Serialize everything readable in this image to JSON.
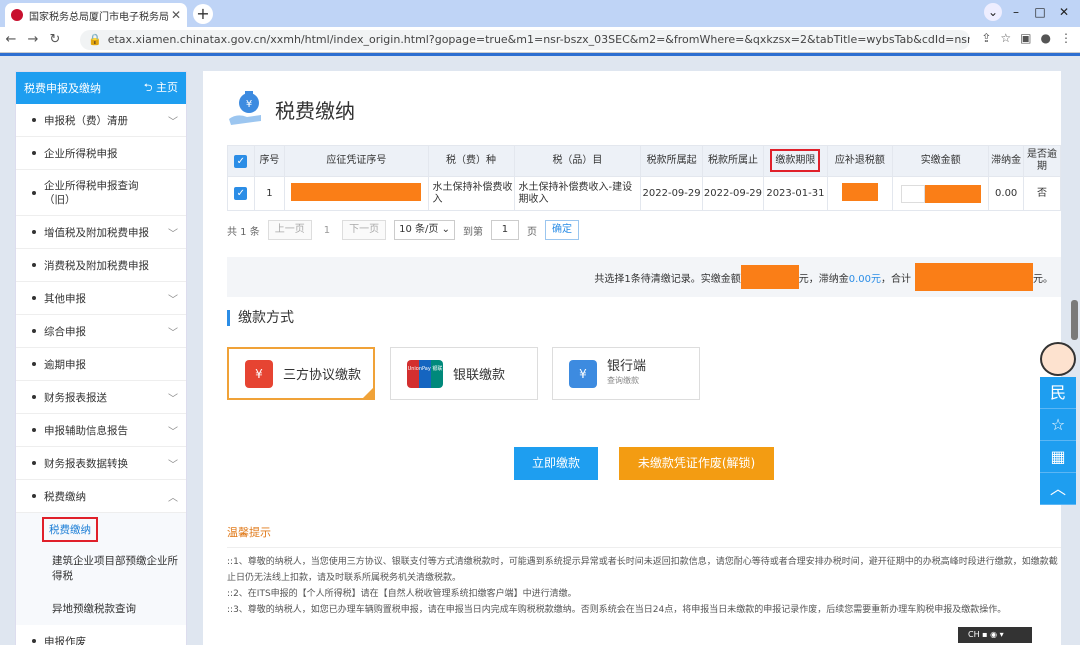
{
  "browser": {
    "tab_title": "国家税务总局厦门市电子税务局",
    "url": "etax.xiamen.chinatax.gov.cn/xxmh/html/index_origin.html?gopage=true&m1=nsr-bszx_03SEC&m2=&fromWhere=&qxkzsx=2&tabTitle=wybsTab&cdId=nsr-bszx_03..."
  },
  "sidebar": {
    "title": "税费申报及缴纳",
    "home": "主页",
    "items": [
      {
        "label": "申报税（费）清册",
        "arrow": true
      },
      {
        "label": "企业所得税申报",
        "arrow": false
      },
      {
        "label": "企业所得税申报查询（旧）",
        "arrow": false
      },
      {
        "label": "增值税及附加税费申报",
        "arrow": true
      },
      {
        "label": "消费税及附加税费申报",
        "arrow": false
      },
      {
        "label": "其他申报",
        "arrow": true
      },
      {
        "label": "综合申报",
        "arrow": true
      },
      {
        "label": "逾期申报",
        "arrow": false
      },
      {
        "label": "财务报表报送",
        "arrow": true
      },
      {
        "label": "申报辅助信息报告",
        "arrow": true
      },
      {
        "label": "财务报表数据转换",
        "arrow": true
      },
      {
        "label": "税费缴纳",
        "arrow": true
      }
    ],
    "subitems": [
      "税费缴纳",
      "建筑企业项目部预缴企业所得税",
      "异地预缴税款查询"
    ],
    "last": "申报作废"
  },
  "page": {
    "title": "税费缴纳"
  },
  "table": {
    "headers": [
      "序号",
      "应征凭证序号",
      "税（费）种",
      "税（品）目",
      "税款所属起",
      "税款所属止",
      "缴款期限",
      "应补退税额",
      "实缴金额",
      "滞纳金",
      "是否逾期"
    ],
    "row": {
      "index": "1",
      "tax_type": "水土保持补偿费收入",
      "item": "水土保持补偿费收入-建设期收入",
      "start": "2022-09-29",
      "end": "2022-09-29",
      "deadline": "2023-01-31",
      "late_fee": "0.00",
      "overdue": "否"
    }
  },
  "pager": {
    "total": "共 1 条",
    "prev": "上一页",
    "page": "1",
    "next": "下一页",
    "size": "10 条/页",
    "goto": "到第",
    "input": "1",
    "unit": "页",
    "ok": "确定"
  },
  "summary": {
    "text1": "共选择1条待清缴记录。实缴金额",
    "text2": "元，滞纳金",
    "late": "0.00元",
    "text3": "，合计",
    "text4": "元。"
  },
  "payment": {
    "section": "缴款方式",
    "methods": [
      "三方协议缴款",
      "银联缴款",
      "银行端"
    ],
    "bank_sub": "查询缴款",
    "unionpay_logo": "UnionPay 银联"
  },
  "buttons": {
    "pay_now": "立即缴款",
    "void": "未缴款凭证作废(解锁)"
  },
  "tips": {
    "title": "温馨提示",
    "lines": [
      "::1、尊敬的纳税人，当您使用三方协议、银联支付等方式清缴税款时，可能遇到系统提示异常或者长时间未返回扣款信息，请您耐心等待或者合理安排办税时间，避开征期中的办税高峰时段进行缴款，如缴款截止日仍无法线上扣款，请及时联系所属税务机关清缴税款。",
      "::2、在ITS申报的【个人所得税】请在【自然人税收管理系统扣缴客户端】中进行清缴。",
      "::3、尊敬的纳税人，如您已办理车辆购置税申报，请在申报当日内完成车购税税款缴纳。否则系统会在当日24点，将申报当日未缴款的申报记录作废，后续您需要重新办理车购税申报及缴款操作。"
    ]
  },
  "colors": {
    "accent": "#1e9ef0",
    "orange": "#f39c12",
    "highlight": "#e0202a"
  },
  "icons": [
    "tax-bag-icon",
    "floating-chat-icon",
    "star-icon",
    "calculator-icon",
    "up-icon"
  ]
}
